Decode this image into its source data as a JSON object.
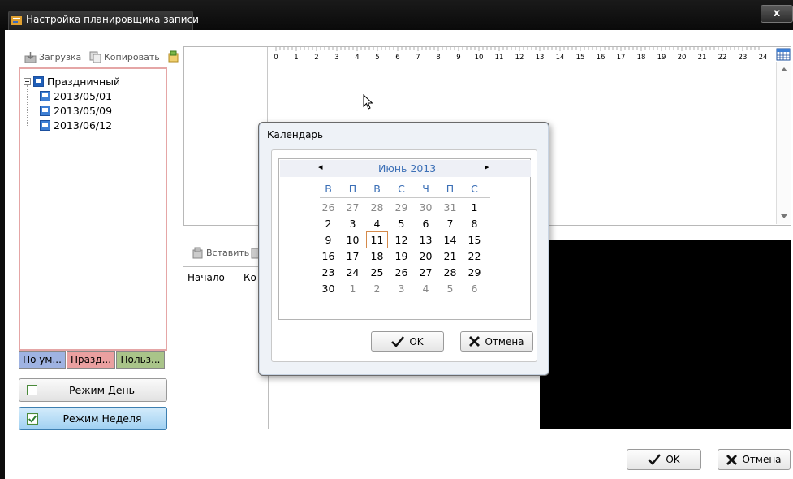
{
  "window": {
    "title": "Настройка планировщика записи",
    "close": "x"
  },
  "toolbar": {
    "load_label": "Загрузка",
    "copy_label": "Копировать"
  },
  "ruler": {
    "hours": [
      "0",
      "1",
      "2",
      "3",
      "4",
      "5",
      "6",
      "7",
      "8",
      "9",
      "10",
      "11",
      "12",
      "13",
      "14",
      "15",
      "16",
      "17",
      "18",
      "19",
      "20",
      "21",
      "22",
      "23",
      "24"
    ]
  },
  "tree": {
    "root_label": "Праздничный",
    "items": [
      "2013/05/01",
      "2013/05/09",
      "2013/06/12"
    ]
  },
  "left_tabs": [
    "По ум...",
    "Празд...",
    "Польз..."
  ],
  "modes": {
    "day_label": "Режим День",
    "week_label": "Режим Неделя"
  },
  "lower_panel": {
    "insert_label": "Вставить",
    "col_start": "Начало",
    "col_end": "Ко"
  },
  "footer": {
    "ok_label": "OK",
    "cancel_label": "Отмена"
  },
  "calendar": {
    "title": "Календарь",
    "month_label": "Июнь 2013",
    "prev_arrow": "◂",
    "next_arrow": "▸",
    "weekdays": [
      "В",
      "П",
      "В",
      "С",
      "Ч",
      "П",
      "С"
    ],
    "weeks": [
      [
        "26",
        "27",
        "28",
        "29",
        "30",
        "31",
        "1"
      ],
      [
        "2",
        "3",
        "4",
        "5",
        "6",
        "7",
        "8"
      ],
      [
        "9",
        "10",
        "11",
        "12",
        "13",
        "14",
        "15"
      ],
      [
        "16",
        "17",
        "18",
        "19",
        "20",
        "21",
        "22"
      ],
      [
        "23",
        "24",
        "25",
        "26",
        "27",
        "28",
        "29"
      ],
      [
        "30",
        "1",
        "2",
        "3",
        "4",
        "5",
        "6"
      ]
    ],
    "selected_day": "11",
    "ok_label": "OK",
    "cancel_label": "Отмена"
  },
  "colors": {
    "accent": "#3b6fb6",
    "tree_border": "#e5a6a6",
    "tab_default": "#9fb3e2",
    "tab_holiday": "#eaa0a0",
    "tab_user": "#a9c489",
    "selected_outline": "#d58a4a"
  }
}
